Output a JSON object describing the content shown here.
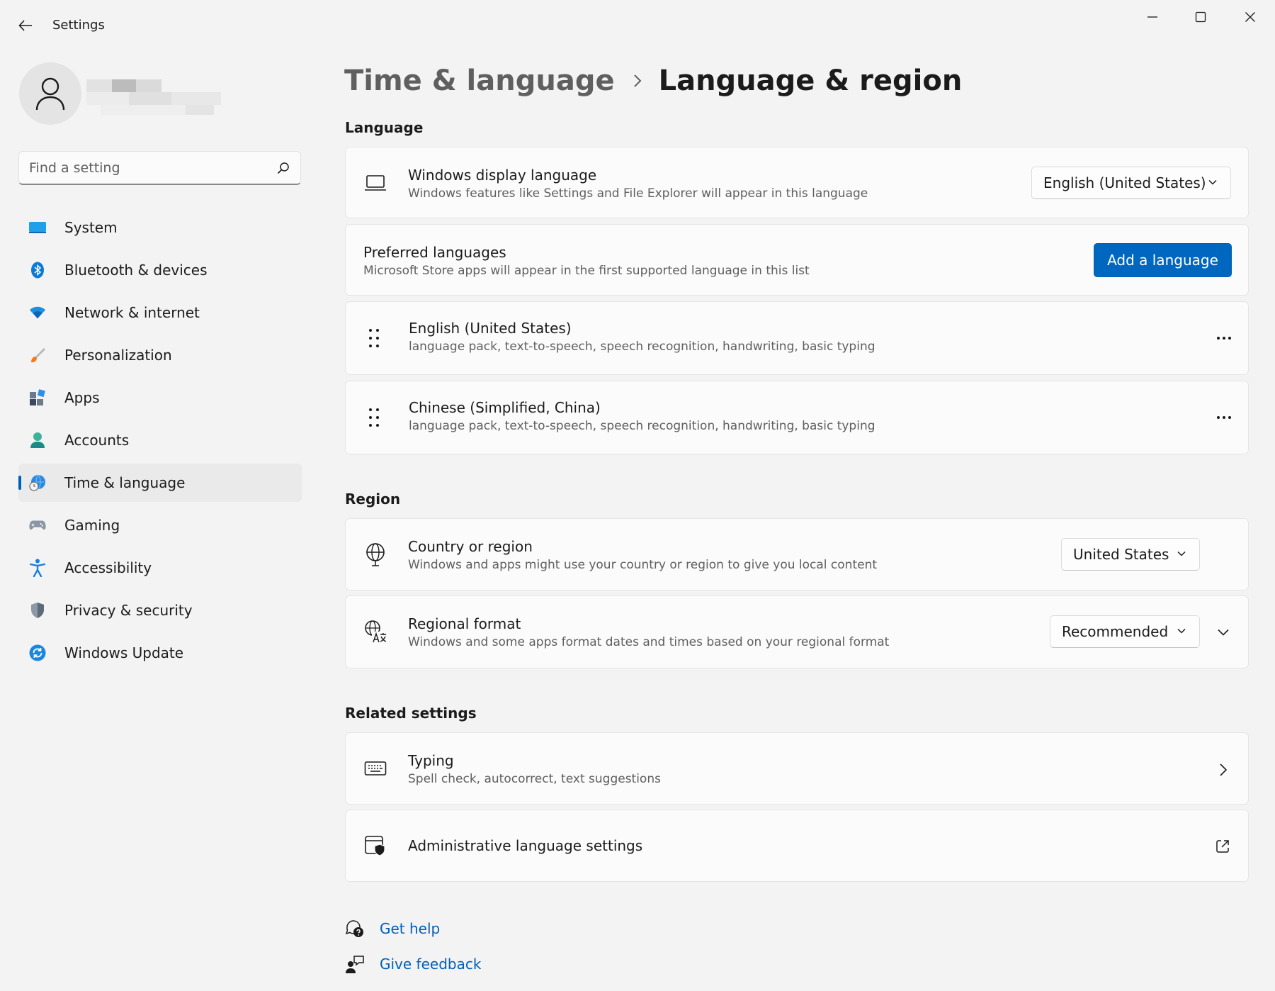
{
  "window": {
    "title": "Settings"
  },
  "sidebar": {
    "search_placeholder": "Find a setting",
    "items": [
      {
        "label": "System",
        "icon": "system-icon",
        "active": false
      },
      {
        "label": "Bluetooth & devices",
        "icon": "bluetooth-icon",
        "active": false
      },
      {
        "label": "Network & internet",
        "icon": "wifi-icon",
        "active": false
      },
      {
        "label": "Personalization",
        "icon": "brush-icon",
        "active": false
      },
      {
        "label": "Apps",
        "icon": "apps-icon",
        "active": false
      },
      {
        "label": "Accounts",
        "icon": "person-icon",
        "active": false
      },
      {
        "label": "Time & language",
        "icon": "globe-clock-icon",
        "active": true
      },
      {
        "label": "Gaming",
        "icon": "gamepad-icon",
        "active": false
      },
      {
        "label": "Accessibility",
        "icon": "accessibility-icon",
        "active": false
      },
      {
        "label": "Privacy & security",
        "icon": "shield-icon",
        "active": false
      },
      {
        "label": "Windows Update",
        "icon": "update-icon",
        "active": false
      }
    ]
  },
  "breadcrumb": {
    "parent": "Time & language",
    "current": "Language & region"
  },
  "language": {
    "heading": "Language",
    "display_language": {
      "title": "Windows display language",
      "description": "Windows features like Settings and File Explorer will appear in this language",
      "selected": "English (United States)"
    },
    "preferred": {
      "title": "Preferred languages",
      "description": "Microsoft Store apps will appear in the first supported language in this list",
      "add_button": "Add a language"
    },
    "languages": [
      {
        "name": "English (United States)",
        "features": "language pack, text-to-speech, speech recognition, handwriting, basic typing"
      },
      {
        "name": "Chinese (Simplified, China)",
        "features": "language pack, text-to-speech, speech recognition, handwriting, basic typing"
      }
    ]
  },
  "region": {
    "heading": "Region",
    "country": {
      "title": "Country or region",
      "description": "Windows and apps might use your country or region to give you local content",
      "selected": "United States"
    },
    "format": {
      "title": "Regional format",
      "description": "Windows and some apps format dates and times based on your regional format",
      "selected": "Recommended"
    }
  },
  "related": {
    "heading": "Related settings",
    "typing": {
      "title": "Typing",
      "description": "Spell check, autocorrect, text suggestions"
    },
    "admin": {
      "title": "Administrative language settings"
    }
  },
  "help": {
    "get_help": "Get help",
    "give_feedback": "Give feedback"
  },
  "colors": {
    "accent": "#005fb8",
    "button_blue": "#0067c0",
    "background": "#f3f3f3",
    "card": "#fbfbfb"
  }
}
